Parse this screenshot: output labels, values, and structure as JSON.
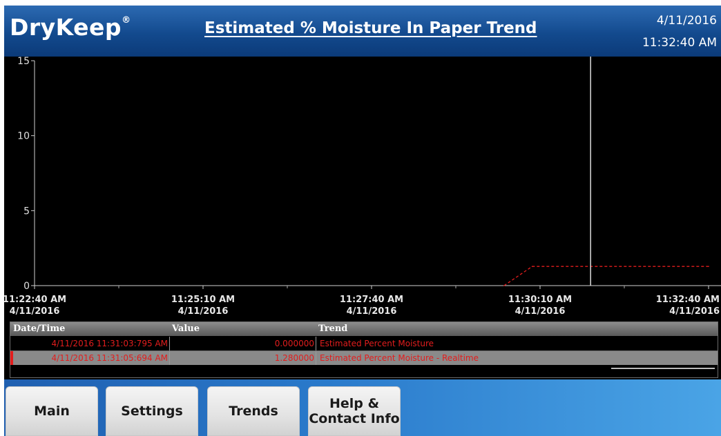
{
  "header": {
    "logo": "DryKeep",
    "logo_mark": "®",
    "title": "Estimated % Moisture In Paper Trend",
    "date": "4/11/2016",
    "time": "11:32:40 AM"
  },
  "chart_data": {
    "type": "line",
    "ylim": [
      0,
      15
    ],
    "yticks": [
      "15",
      "10",
      "5",
      "0"
    ],
    "xticks": [
      {
        "time": "11:22:40 AM",
        "date": "4/11/2016"
      },
      {
        "time": "11:25:10 AM",
        "date": "4/11/2016"
      },
      {
        "time": "11:27:40 AM",
        "date": "4/11/2016"
      },
      {
        "time": "11:30:10 AM",
        "date": "4/11/2016"
      },
      {
        "time": "11:32:40 AM",
        "date": "4/11/2016"
      }
    ],
    "xlim": [
      "11:22:40 AM",
      "11:32:40 AM"
    ],
    "cursor_time": "11:30:55 AM",
    "series": [
      {
        "name": "Estimated Percent Moisture",
        "color": "#e31d1d",
        "points": [
          [
            "11:29:38 AM",
            0.0
          ],
          [
            "11:30:03 AM",
            1.28
          ],
          [
            "11:32:40 AM",
            1.28
          ]
        ]
      }
    ]
  },
  "table": {
    "headers": [
      "Date/Time",
      "Value",
      "Trend"
    ],
    "rows": [
      [
        "4/11/2016 11:31:03:795 AM",
        "0.000000",
        "Estimated Percent Moisture"
      ],
      [
        "4/11/2016 11:31:05:694 AM",
        "1.280000",
        "Estimated Percent Moisture - Realtime"
      ]
    ]
  },
  "nav": {
    "main": "Main",
    "settings": "Settings",
    "trends": "Trends",
    "help": "Help &\nContact Info"
  },
  "colors": {
    "header": "#134a8e",
    "trend_red": "#e31d1d",
    "footer": "#2a7acb"
  }
}
